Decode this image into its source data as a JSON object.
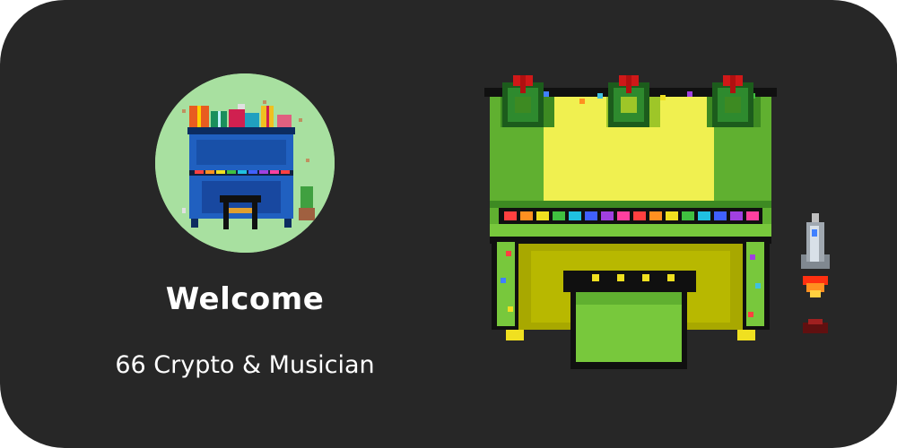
{
  "profile": {
    "avatar_icon": "christmas-piano-avatar-icon",
    "title": "Welcome",
    "subtitle": "66 Crypto & Musician"
  },
  "illustration": {
    "piano_icon": "pixel-green-piano-icon",
    "rocket_icon": "pixel-rocket-icon"
  },
  "colors": {
    "background": "#272727",
    "text": "#ffffff",
    "avatar_bg": "#a8e0a0",
    "piano_green": "#78c83c",
    "piano_yellow": "#f0f050",
    "wreath_green": "#2e7d2e",
    "bow_red": "#d01818"
  }
}
